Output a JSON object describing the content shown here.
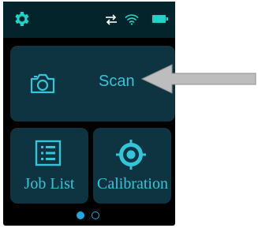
{
  "status_bar": {
    "settings_icon": "gear-icon",
    "sync_icon": "swap-arrows-icon",
    "wifi_icon": "wifi-icon",
    "battery_icon": "battery-icon"
  },
  "tiles": {
    "scan": {
      "label": "Scan",
      "icon": "camera-icon"
    },
    "job_list": {
      "label": "Job List",
      "icon": "list-icon"
    },
    "calibration": {
      "label": "Calibration",
      "icon": "target-icon"
    }
  },
  "pager": {
    "page": 1,
    "total_pages": 2
  },
  "colors": {
    "accent": "#33c6da",
    "gear": "#1fd3c9",
    "tile_bg": "#0d3440",
    "status_bg": "#04242c",
    "dot": "#1fa7e0",
    "arrow": "#bdbdbd"
  }
}
